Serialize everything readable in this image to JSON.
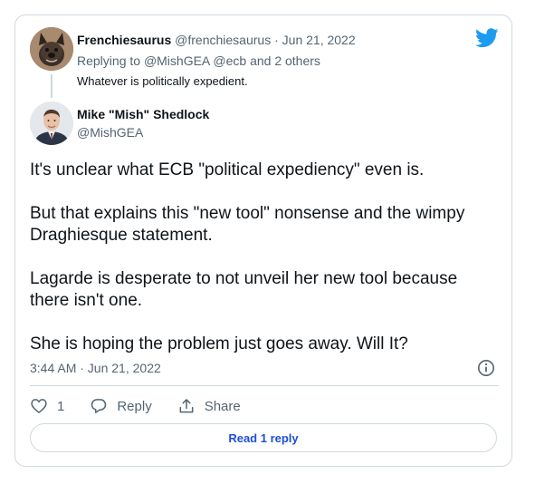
{
  "brand": {
    "logo_icon": "twitter-bird-icon",
    "color": "#1d9bf0"
  },
  "parent_tweet": {
    "display_name": "Frenchiesaurus",
    "handle": "@frenchiesaurus",
    "separator": "·",
    "date": "Jun 21, 2022",
    "replying_prefix": "Replying to",
    "replying_to": "@MishGEA @ecb",
    "replying_suffix": "and 2 others",
    "text": "Whatever is politically expedient."
  },
  "main_tweet": {
    "display_name": "Mike \"Mish\" Shedlock",
    "handle": "@MishGEA",
    "paragraphs": [
      "It's unclear what ECB \"political expediency\" even is.",
      "But that explains this \"new tool\" nonsense and the wimpy Draghiesque statement.",
      "Lagarde is desperate to not unveil her new tool because there isn't one.",
      "She is hoping the problem just goes away. Will It?"
    ],
    "timestamp": "3:44 AM · Jun 21, 2022"
  },
  "actions": {
    "like_count": "1",
    "reply_label": "Reply",
    "share_label": "Share"
  },
  "read_replies_label": "Read 1 reply"
}
